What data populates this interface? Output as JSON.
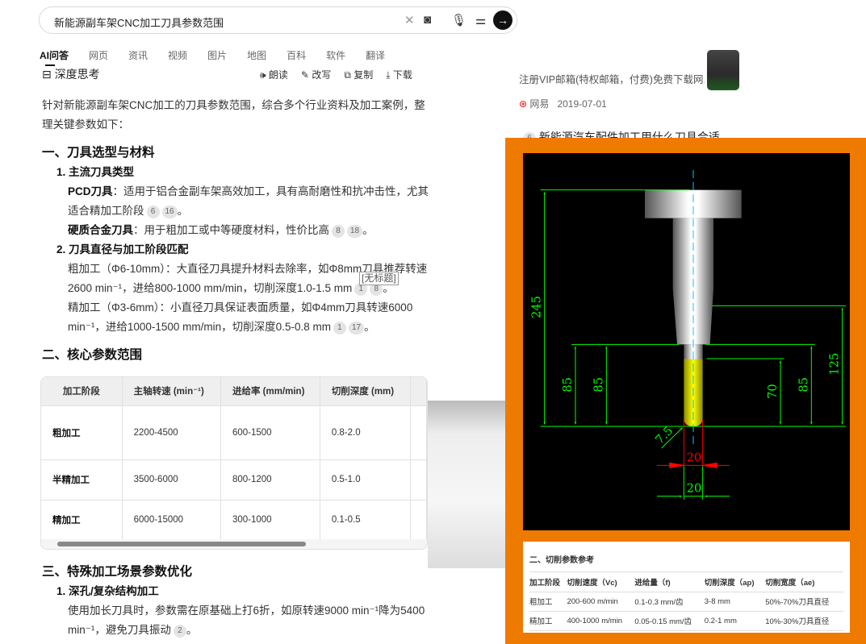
{
  "search": {
    "query": "新能源副车架CNC加工刀具参数范围"
  },
  "tabs": [
    "AI问答",
    "网页",
    "资讯",
    "视频",
    "图片",
    "地图",
    "百科",
    "软件",
    "翻译"
  ],
  "answer_header": {
    "title": "深度思考",
    "actions": [
      "朗读",
      "改写",
      "复制",
      "下载"
    ]
  },
  "intro": "针对新能源副车架CNC加工的刀具参数范围，综合多个行业资料及加工案例，整理关键参数如下：",
  "section1": {
    "title": "一、刀具选型与材料",
    "item1": "1. 主流刀具类型",
    "pcd_label": "PCD刀具",
    "pcd_text": "：适用于铝合金副车架高效加工，具有高耐磨性和抗冲击性，尤其适合精加工阶段",
    "pcd_cites": [
      "6",
      "16"
    ],
    "carbide_label": "硬质合金刀具",
    "carbide_text": "：用于粗加工或中等硬度材料，性价比高",
    "carbide_cites": [
      "8",
      "18"
    ],
    "item2": "2. 刀具直径与加工阶段匹配",
    "rough": "粗加工（Φ6-10mm）：大直径刀具提升材料去除率，如Φ8mm刀具推荐转速2600 min⁻¹，进给800-1000 mm/min，切削深度1.0-1.5 mm",
    "rough_cites": [
      "1",
      "8"
    ],
    "finish": "精加工（Φ3-6mm）：小直径刀具保证表面质量，如Φ4mm刀具转速6000 min⁻¹，进给1000-1500 mm/min，切削深度0.5-0.8 mm",
    "finish_cites": [
      "1",
      "17"
    ],
    "tooltip": "[无标题]"
  },
  "section2": {
    "title": "二、核心参数范围",
    "headers": [
      "加工阶段",
      "主轴转速 (min⁻¹)",
      "进给率 (mm/min)",
      "切削深度 (mm)"
    ],
    "rows": [
      [
        "粗加工",
        "2200-4500",
        "600-1500",
        "0.8-2.0"
      ],
      [
        "半精加工",
        "3500-6000",
        "800-1200",
        "0.5-1.0"
      ],
      [
        "精加工",
        "6000-15000",
        "300-1000",
        "0.1-0.5"
      ]
    ]
  },
  "section3": {
    "title": "三、特殊加工场景参数优化",
    "item1": "1. 深孔/复杂结构加工",
    "text": "使用加长刀具时，参数需在原基础上打6折，如原转速9000 min⁻¹降为5400 min⁻¹，避免刀具振动",
    "cites": [
      "2"
    ]
  },
  "results": {
    "snippet": "注册VIP邮箱(特权邮箱，付费)免费下载网...",
    "source": "网易",
    "date": "2019-07-01",
    "next_num": "6",
    "next_title": "新能源汽车配件加工用什么刀具合适"
  },
  "drawing": {
    "dims": [
      "245",
      "85",
      "85",
      "70",
      "85",
      "125",
      "7.5",
      "20",
      "20"
    ]
  },
  "ref_table": {
    "title": "二、切削参数参考",
    "headers": [
      "加工阶段",
      "切削速度（Vc)",
      "进给量（f)",
      "切削深度（ap)",
      "切削宽度（ae)"
    ],
    "rows": [
      [
        "粗加工",
        "200-600 m/min",
        "0.1-0.3 mm/齿",
        "3-8 mm",
        "50%-70%刀具直径"
      ],
      [
        "精加工",
        "400-1000 m/min",
        "0.05-0.15 mm/齿",
        "0.2-1 mm",
        "10%-30%刀具直径"
      ]
    ]
  },
  "colors": {
    "highlight": "#ee7a00",
    "dim_green": "#00ff00",
    "dim_red": "#ff0000",
    "tool_tip": "#ffff00"
  }
}
